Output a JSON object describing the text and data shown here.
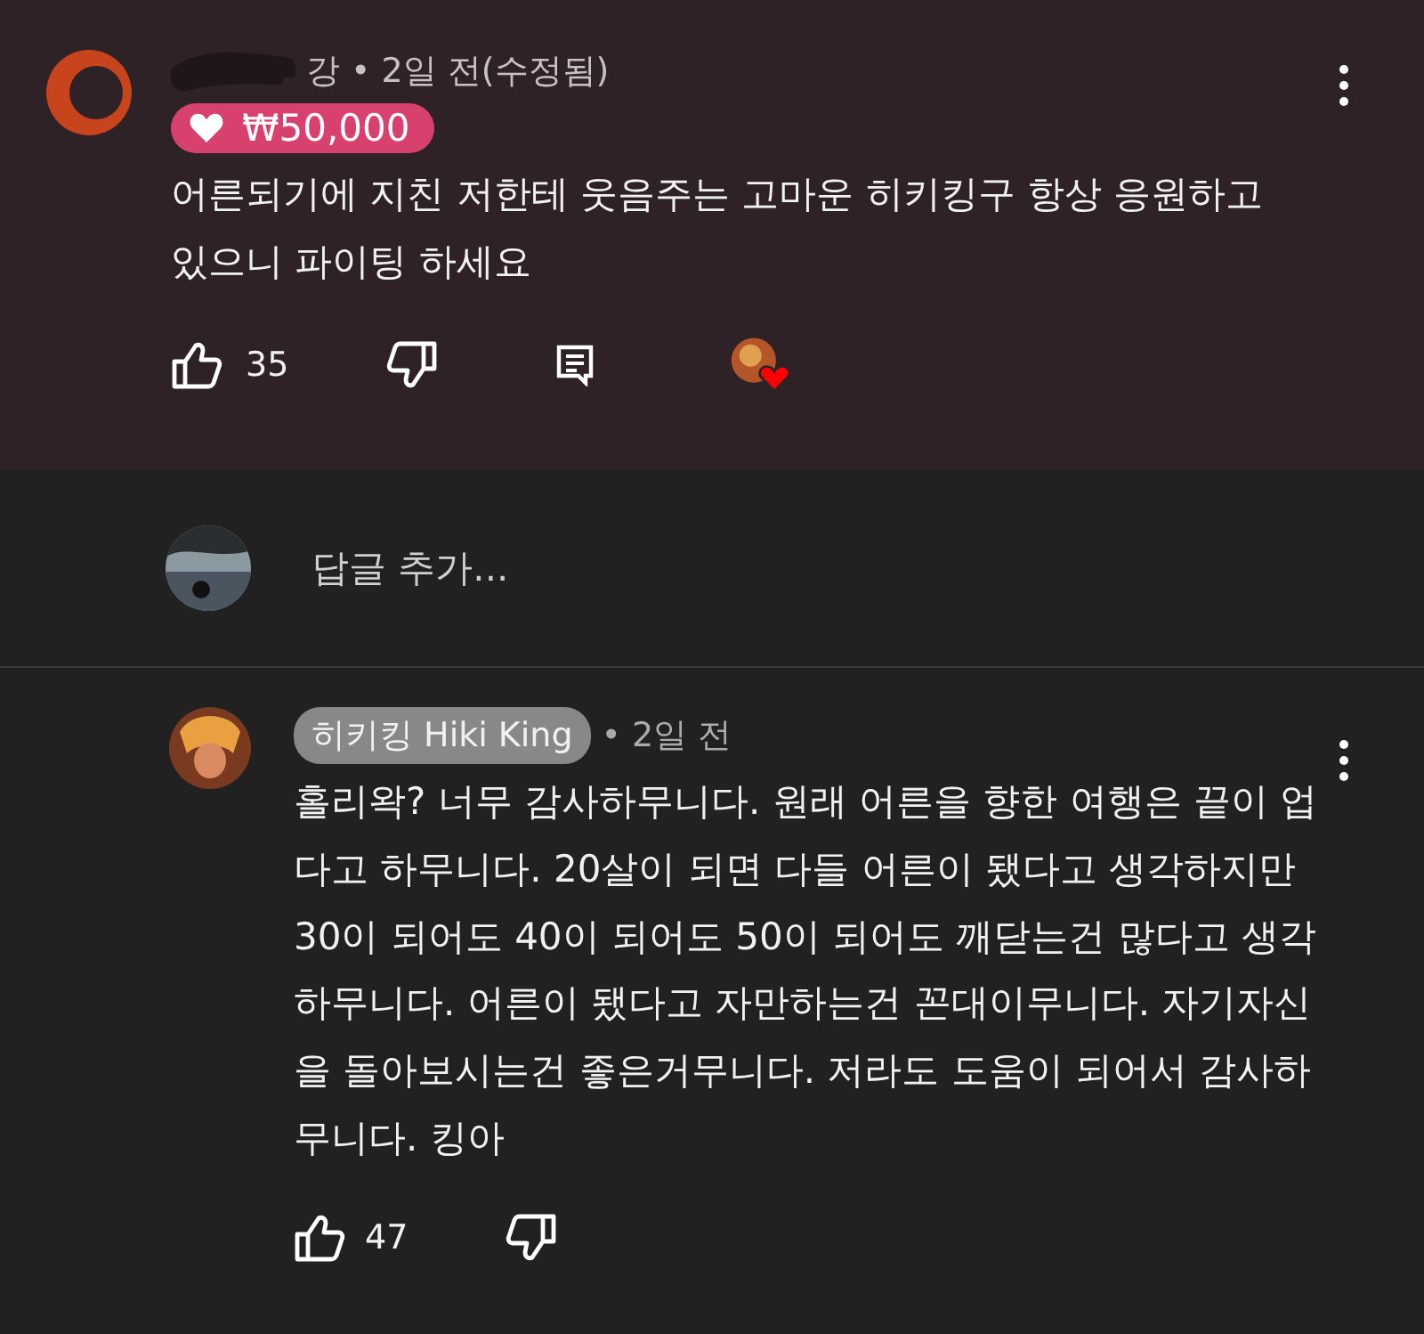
{
  "comment": {
    "author": "강",
    "time": "• 2일 전(수정됨)",
    "donation": "₩50,000",
    "text": "어른되기에 지친 저한테 웃음주는 고마운 히키킹구 항상 응원하고 있으니 파이팅 하세요",
    "likes": "35",
    "creator_heart": true
  },
  "reply_box": {
    "placeholder": "답글 추가..."
  },
  "reply": {
    "author": "히키킹 Hiki King",
    "is_owner": true,
    "time": "• 2일 전",
    "text": "홀리왁? 너무 감사하무니다. 원래 어른을 향한 여행은 끝이 업다고 하무니다. 20살이 되면 다들 어른이 됐다고 생각하지만 30이 되어도 40이 되어도 50이 되어도 깨닫는건 많다고 생각하무니다. 어른이 됐다고 자만하는건 꼰대이무니다.  자기자신을 돌아보시는건 좋은거무니다. 저라도 도움이 되어서 감사하무니다. 킹아",
    "likes": "47"
  }
}
